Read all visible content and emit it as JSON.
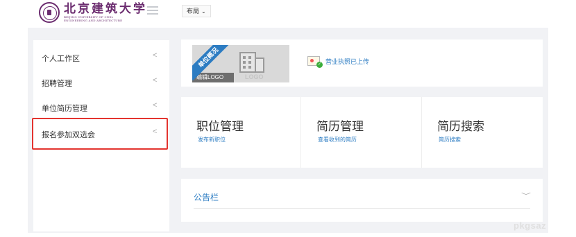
{
  "header": {
    "logo_cn": "北京建筑大学",
    "logo_en_line1": "BEIJING UNIVERSITY OF CIVIL",
    "logo_en_line2": "ENGINEERING AND ARCHITECTURE",
    "layout_label": "布局",
    "layout_caret": "⌄"
  },
  "sidebar": {
    "items": [
      {
        "label": "个人工作区",
        "chevron": "<"
      },
      {
        "label": "招聘管理",
        "chevron": "<"
      },
      {
        "label": "单位简历管理",
        "chevron": "<"
      },
      {
        "label": "报名参加双选会",
        "chevron": "<"
      }
    ],
    "highlight_color": "#e3342f"
  },
  "unit_card": {
    "ribbon": "单位概况",
    "edit_logo": "编辑LOGO",
    "logo_watermark": "LOGO",
    "license_status": "营业执照已上传"
  },
  "features": [
    {
      "title": "职位管理",
      "link": "发布新职位"
    },
    {
      "title": "简历管理",
      "link": "查看收到的简历"
    },
    {
      "title": "简历搜索",
      "link": "简历搜索"
    }
  ],
  "notice": {
    "title": "公告栏",
    "chevron": "﹀"
  },
  "watermark": "pkgsaz",
  "colors": {
    "accent_blue": "#2d7dc3",
    "brand_purple": "#6b2c6f",
    "background_gray": "#f1f2f5"
  }
}
